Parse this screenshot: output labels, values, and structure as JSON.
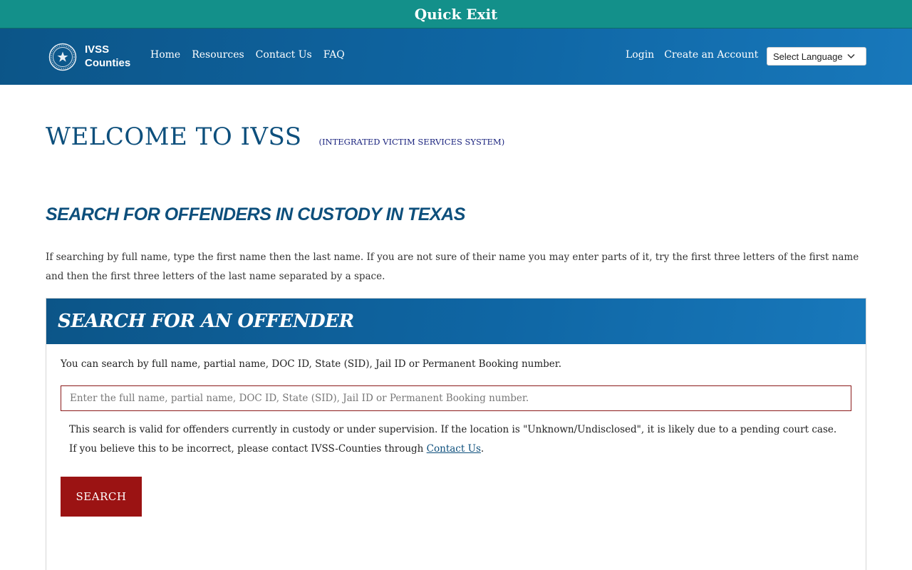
{
  "quick_exit": {
    "label": "Quick Exit"
  },
  "header": {
    "brand_line1": "IVSS",
    "brand_line2": "Counties",
    "nav": [
      "Home",
      "Resources",
      "Contact Us",
      "FAQ"
    ],
    "login": "Login",
    "create_account": "Create an Account",
    "language": "Select Language"
  },
  "main": {
    "title": "WELCOME TO IVSS",
    "subtitle": "(INTEGRATED VICTIM SERVICES SYSTEM)",
    "section_title": "SEARCH FOR OFFENDERS IN CUSTODY IN TEXAS",
    "intro": "If searching by full name, type the first name then the last name. If you are not sure of their name you may enter parts of it, try the first three letters of the first name and then the first three letters of the last name separated by a space."
  },
  "search_panel": {
    "heading": "SEARCH FOR AN OFFENDER",
    "description": "You can search by full name, partial name, DOC ID, State (SID), Jail ID or Permanent Booking number.",
    "input_value": "",
    "input_placeholder": "Enter the full name, partial name, DOC ID, State (SID), Jail ID or Permanent Booking number.",
    "note_text": "This search is valid for offenders currently in custody or under supervision.  If the location is \"Unknown/Undisclosed\", it is likely due to a pending court case.  If you believe this to be incorrect, please contact IVSS-Counties through ",
    "note_link": "Contact Us",
    "note_end": ".",
    "button_label": "SEARCH"
  },
  "colors": {
    "quick_exit_bg": "#13908a",
    "nav_bg": "#0f66a4",
    "title_blue": "#0d4f7c",
    "button_red": "#9b1313"
  },
  "icons": {
    "logo": "texas-seal-icon",
    "language_chevron": "chevron-down-icon"
  }
}
